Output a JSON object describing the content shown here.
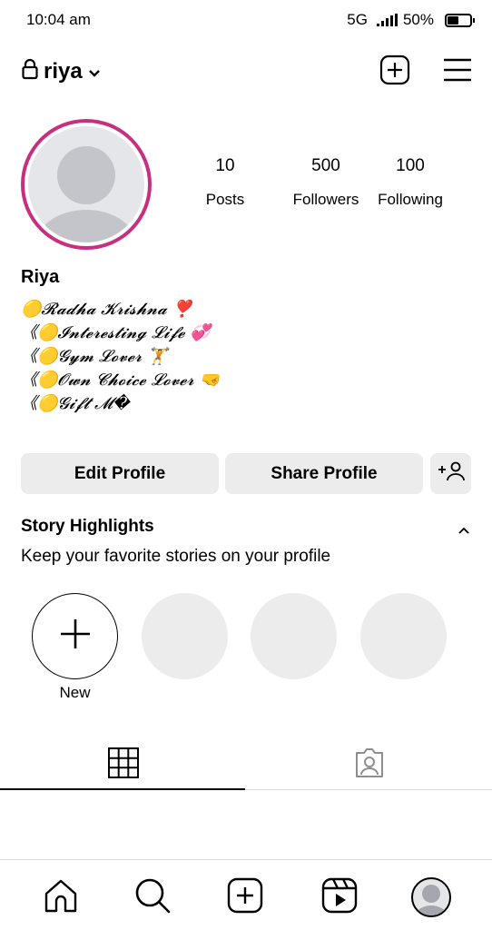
{
  "status_bar": {
    "time": "10:04 am",
    "network": "5G",
    "battery": "50%"
  },
  "header": {
    "username": "riya",
    "icons": [
      "lock-icon",
      "chevron-down-icon",
      "add-post-icon",
      "menu-icon"
    ]
  },
  "profile": {
    "stats": [
      {
        "count": "10",
        "label": "Posts"
      },
      {
        "count": "500",
        "label": "Followers"
      },
      {
        "count": "100",
        "label": "Following"
      }
    ],
    "display_name": "Riya",
    "bio_lines": [
      "🟡𝓡𝓪𝓭𝓱𝓪 𝓚𝓻𝓲𝓼𝓱𝓷𝓪 ❣️",
      "《🟡𝓘𝓷𝓽𝓮𝓻𝓮𝓼𝓽𝓲𝓷𝓰 𝓛𝓲𝓯𝓮 💞",
      "《🟡𝓖𝔂𝓶 𝓛𝓸𝓿𝓮𝓻 🏋️",
      "《🟡𝓞𝔀𝓷 𝓒𝓱𝓸𝓲𝓬𝓮 𝓛𝓸𝓿𝓮𝓻 🤜",
      "《🟡𝓖𝓲𝓯𝓽 𝓜�"
    ]
  },
  "actions": {
    "edit_label": "Edit Profile",
    "share_label": "Share Profile",
    "discover_icon": "add-person-icon"
  },
  "highlights": {
    "title": "Story Highlights",
    "subtitle": "Keep your favorite stories on your profile",
    "new_label": "New"
  },
  "tabs": [
    "grid-icon",
    "tagged-icon"
  ],
  "bottom_nav": [
    "home-icon",
    "search-icon",
    "create-icon",
    "reels-icon",
    "profile-avatar"
  ],
  "colors": {
    "story_ring": "#c8307f",
    "button_bg": "#ececed",
    "placeholder": "#e5e6e9"
  }
}
